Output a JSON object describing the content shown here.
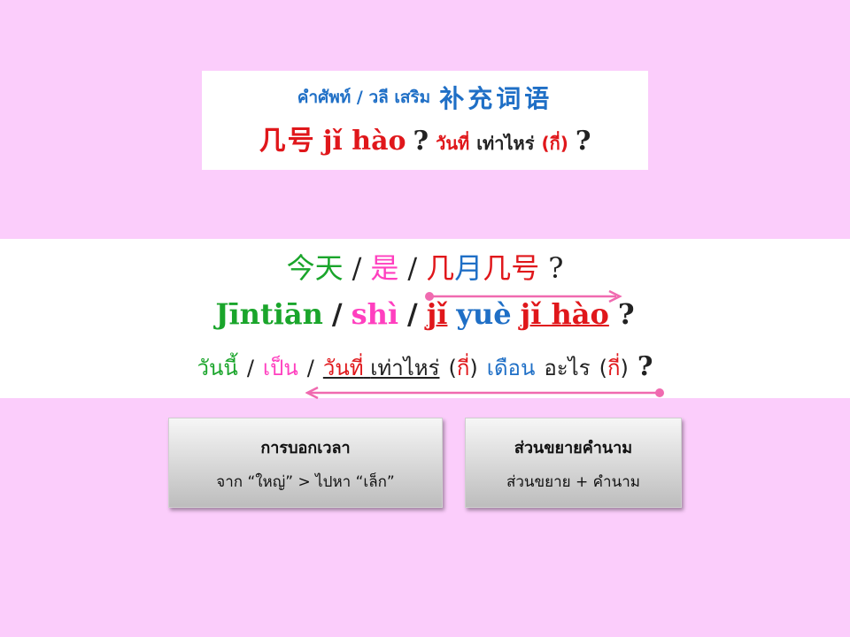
{
  "title": {
    "thai_heading": "คำศัพท์ / วลี เสริม",
    "zh_heading": "补充词语",
    "zh_phrase": "几号",
    "pinyin": "jǐ hào",
    "q1": "?",
    "thai_a": "วันที่",
    "thai_b": "เท่าไหร่",
    "thai_c": "(กี่)",
    "q2": "?"
  },
  "sentence": {
    "zh": {
      "w1": "今天",
      "s1": "/",
      "w2": "是",
      "s2": "/",
      "w3": "几",
      "w4": "月",
      "w5": "几号",
      "q": "?"
    },
    "pinyin": {
      "w1": "Jīntiān",
      "s1": "/",
      "w2": "shì",
      "s2": "/",
      "w3": "jǐ",
      "w4": "yuè",
      "w5": "jǐ hào",
      "q": "?"
    },
    "thai": {
      "w1": "วันนี้",
      "s1": "/",
      "w2": "เป็น",
      "s2": "/",
      "w3": "วันที่",
      "w4": "เท่าไหร่",
      "p1o": "(",
      "w5": "กี่",
      "p1c": ")",
      "w6": "เดือน",
      "w7": "อะไร",
      "p2o": "(",
      "w8": "กี่",
      "p2c": ")",
      "q": "?"
    }
  },
  "notes": [
    {
      "title": "การบอกเวลา",
      "body": "จาก “ใหญ่” > ไปหา “เล็ก”"
    },
    {
      "title": "ส่วนขยายคำนาม",
      "body": "ส่วนขยาย + คำนาม"
    }
  ],
  "colors": {
    "background": "#fbcdfb",
    "red": "#e0171b",
    "blue": "#1f6fc6",
    "green": "#1aa52b",
    "pink": "#ff3fbf",
    "arrow": "#f06ab0"
  }
}
